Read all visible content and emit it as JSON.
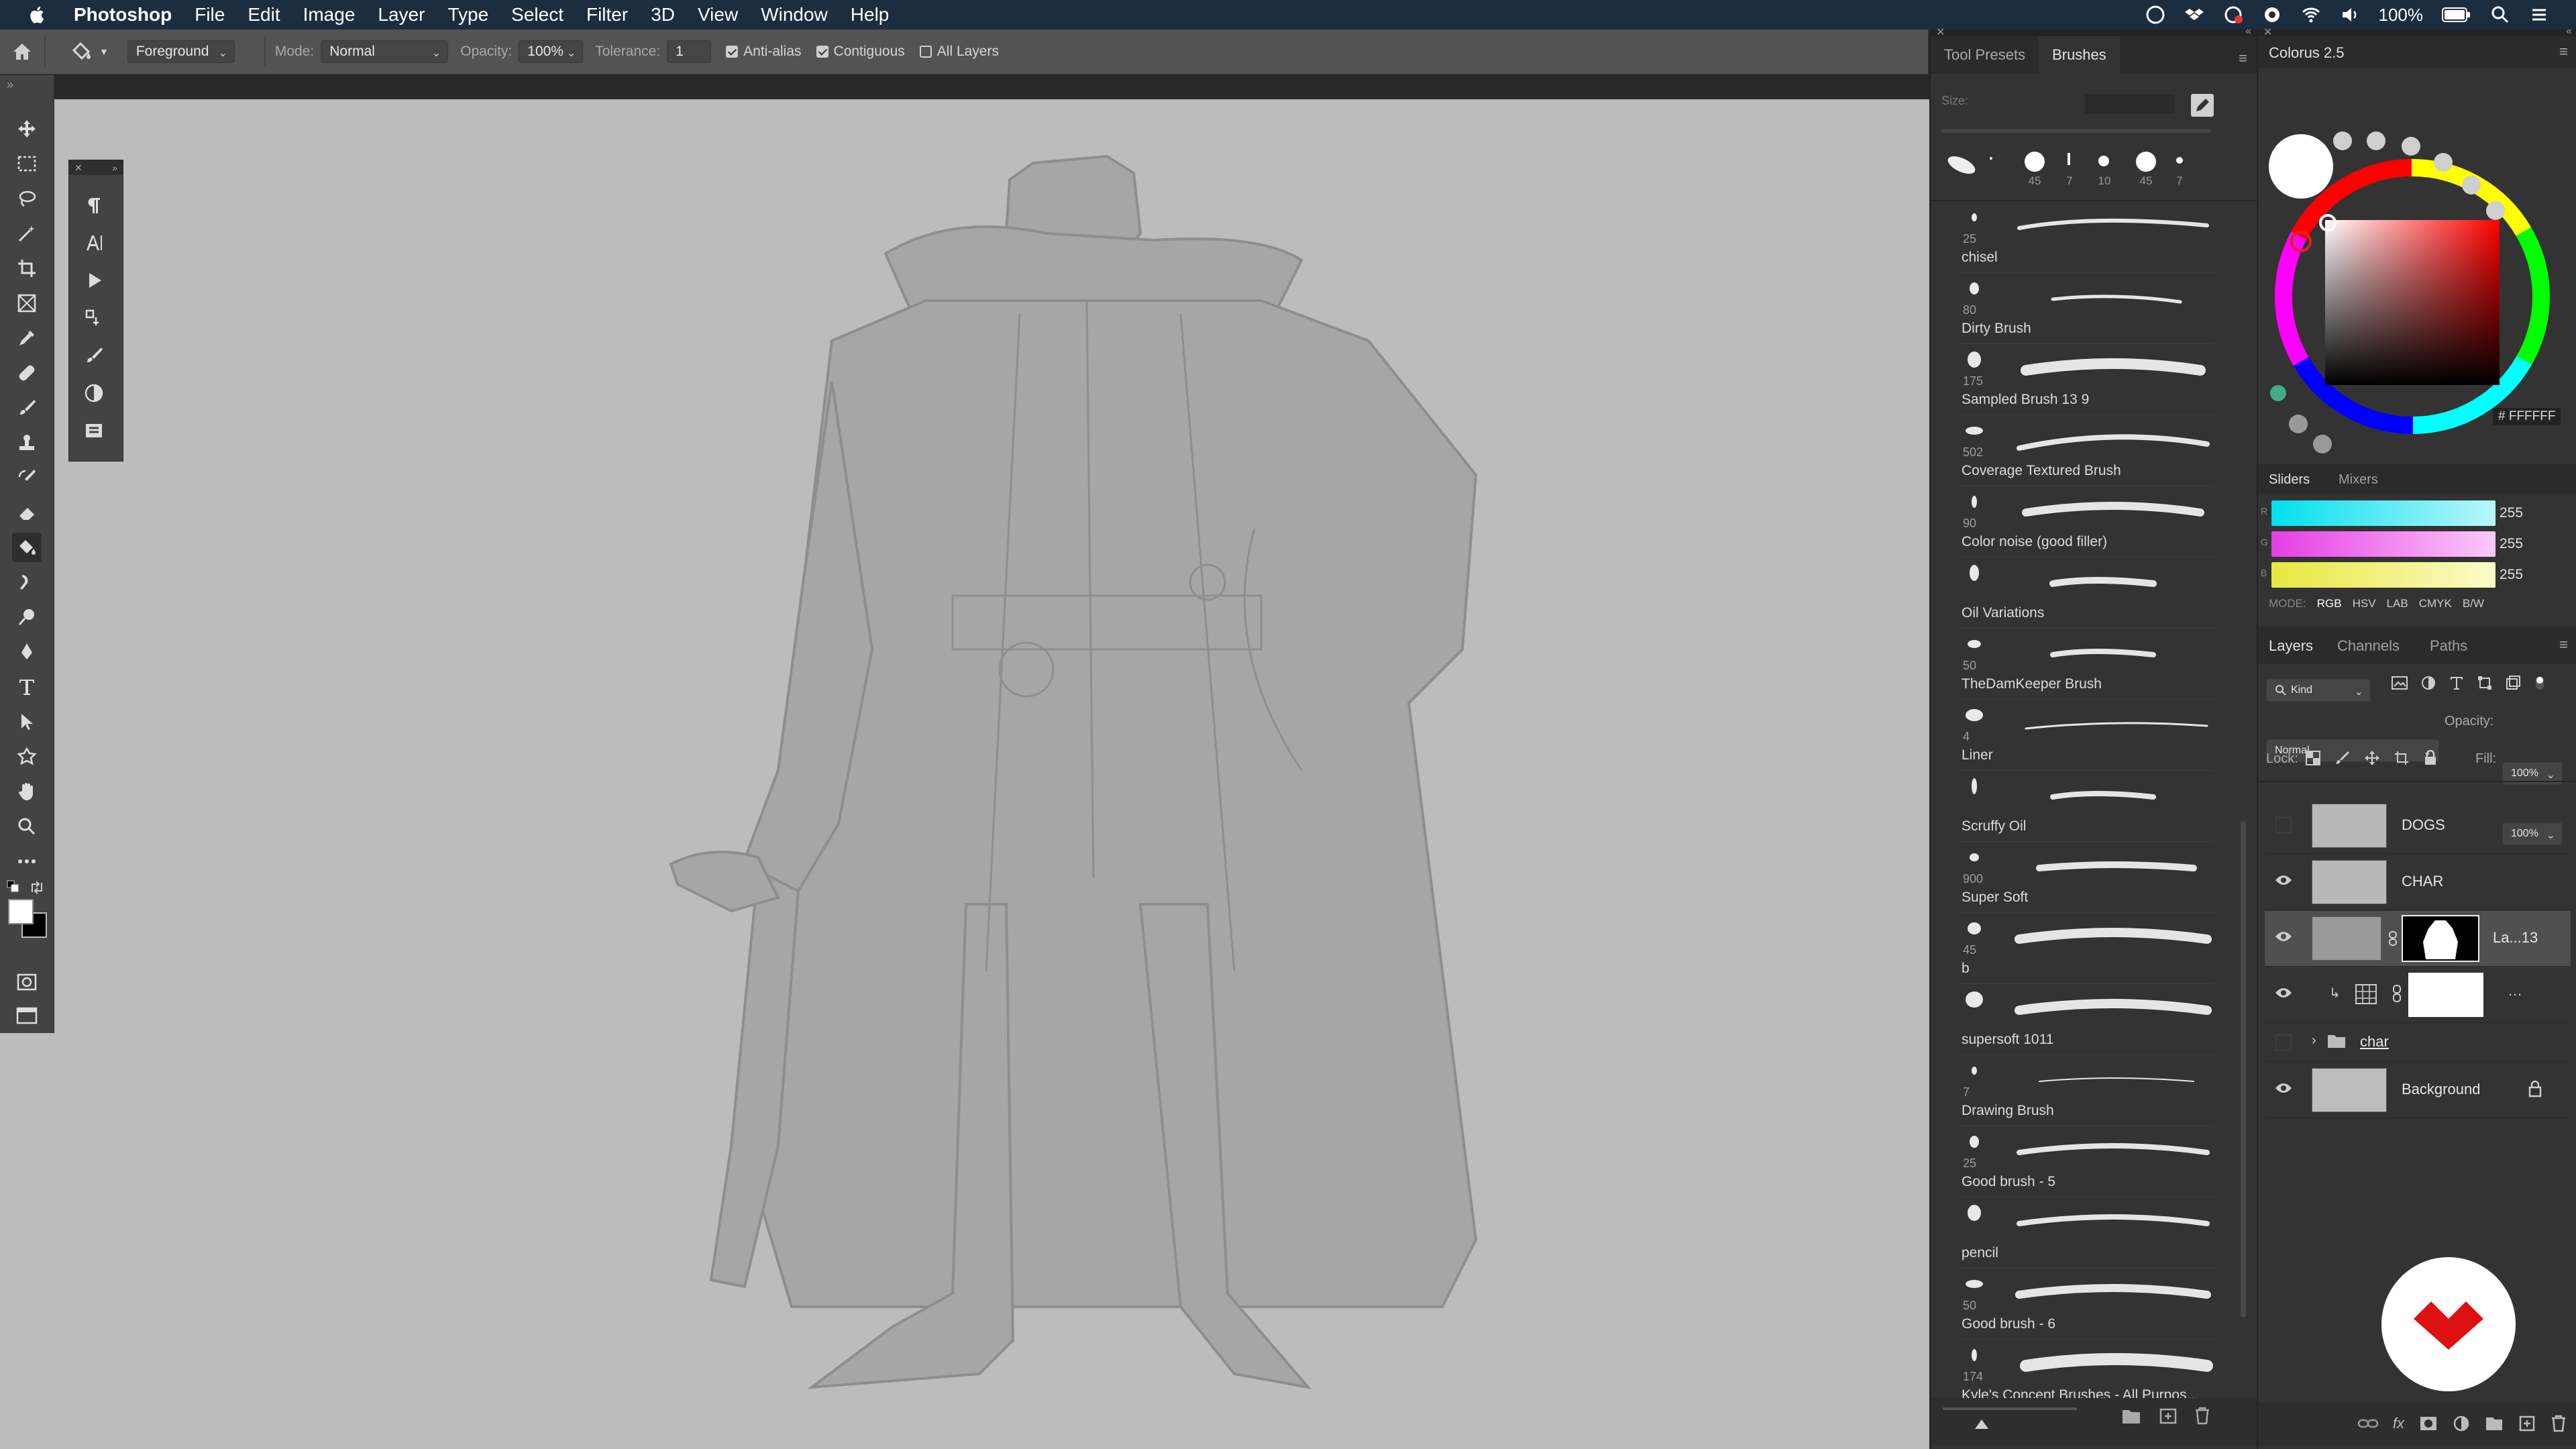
{
  "menubar": {
    "app": "Photoshop",
    "items": [
      "File",
      "Edit",
      "Image",
      "Layer",
      "Type",
      "Select",
      "Filter",
      "3D",
      "View",
      "Window",
      "Help"
    ],
    "battery": "100%"
  },
  "options": {
    "fill_source": "Foreground",
    "mode_label": "Mode:",
    "mode_value": "Normal",
    "opacity_label": "Opacity:",
    "opacity_value": "100%",
    "tolerance_label": "Tolerance:",
    "tolerance_value": "1",
    "anti_alias": "Anti-alias",
    "contiguous": "Contiguous",
    "all_layers": "All Layers"
  },
  "brushes_panel": {
    "tabs": [
      "Tool Presets",
      "Brushes"
    ],
    "size_label": "Size:",
    "recent_sizes": [
      "45",
      "7",
      "10",
      "45",
      "7"
    ],
    "items": [
      {
        "size": "25",
        "name": "chisel"
      },
      {
        "size": "80",
        "name": "Dirty Brush"
      },
      {
        "size": "175",
        "name": "Sampled Brush 13 9"
      },
      {
        "size": "502",
        "name": "Coverage Textured Brush"
      },
      {
        "size": "90",
        "name": "Color noise (good filler)"
      },
      {
        "size": "",
        "name": "Oil Variations"
      },
      {
        "size": "50",
        "name": "TheDamKeeper Brush"
      },
      {
        "size": "4",
        "name": "Liner"
      },
      {
        "size": "",
        "name": "Scruffy Oil"
      },
      {
        "size": "900",
        "name": "Super Soft"
      },
      {
        "size": "45",
        "name": "b"
      },
      {
        "size": "",
        "name": "supersoft 1011"
      },
      {
        "size": "7",
        "name": "Drawing Brush"
      },
      {
        "size": "25",
        "name": "Good brush - 5"
      },
      {
        "size": "",
        "name": "pencil"
      },
      {
        "size": "50",
        "name": "Good brush - 6"
      },
      {
        "size": "174",
        "name": "Kyle's Concept Brushes - All Purpos..."
      }
    ]
  },
  "colorus": {
    "title": "Colorus 2.5",
    "hex": "# FFFFFF"
  },
  "sliders": {
    "tabs": [
      "Sliders",
      "Mixers"
    ],
    "channels": [
      {
        "label": "R",
        "value": "255",
        "color": "#53e6f0"
      },
      {
        "label": "G",
        "value": "255",
        "color": "#f05bf0"
      },
      {
        "label": "B",
        "value": "255",
        "color": "#f0f053"
      }
    ],
    "mode_label": "MODE:",
    "modes": [
      "RGB",
      "HSV",
      "LAB",
      "CMYK",
      "B/W"
    ]
  },
  "layers_panel": {
    "tabs": [
      "Layers",
      "Channels",
      "Paths"
    ],
    "kind": "Kind",
    "blend": "Normal",
    "opacity_label": "Opacity:",
    "opacity": "100%",
    "lock_label": "Lock:",
    "fill_label": "Fill:",
    "fill": "100%",
    "layers": [
      {
        "name": "DOGS",
        "visible": false
      },
      {
        "name": "CHAR",
        "visible": true
      },
      {
        "name": "La...13",
        "visible": true
      },
      {
        "name": "",
        "visible": true
      },
      {
        "name": "char",
        "visible": false
      },
      {
        "name": "Background",
        "visible": true
      }
    ]
  }
}
